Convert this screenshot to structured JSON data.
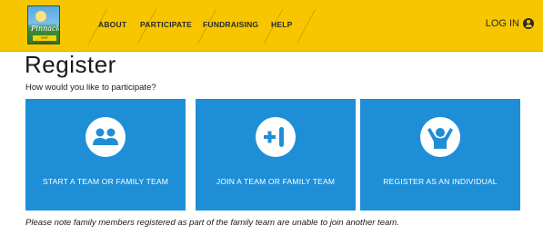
{
  "header": {
    "logo_text": "Pinnacle",
    "logo_tag": "SHF SUPPORTS",
    "nav": [
      {
        "label": "ABOUT"
      },
      {
        "label": "PARTICIPATE"
      },
      {
        "label": "FUNDRAISING"
      },
      {
        "label": "HELP"
      }
    ],
    "login_label": "LOG IN",
    "login_icon": "user-circle-icon",
    "background_color": "#f7c600"
  },
  "page": {
    "title": "Register",
    "subtitle": "How would you like to participate?"
  },
  "options": [
    {
      "label": "START A TEAM OR FAMILY TEAM",
      "icon": "team-icon"
    },
    {
      "label": "JOIN A TEAM OR FAMILY TEAM",
      "icon": "plus-one-icon"
    },
    {
      "label": "REGISTER AS AN INDIVIDUAL",
      "icon": "individual-icon"
    }
  ],
  "tile_color": "#1e8fd6",
  "note": "Please note family members registered as part of the family team are unable to join another team."
}
